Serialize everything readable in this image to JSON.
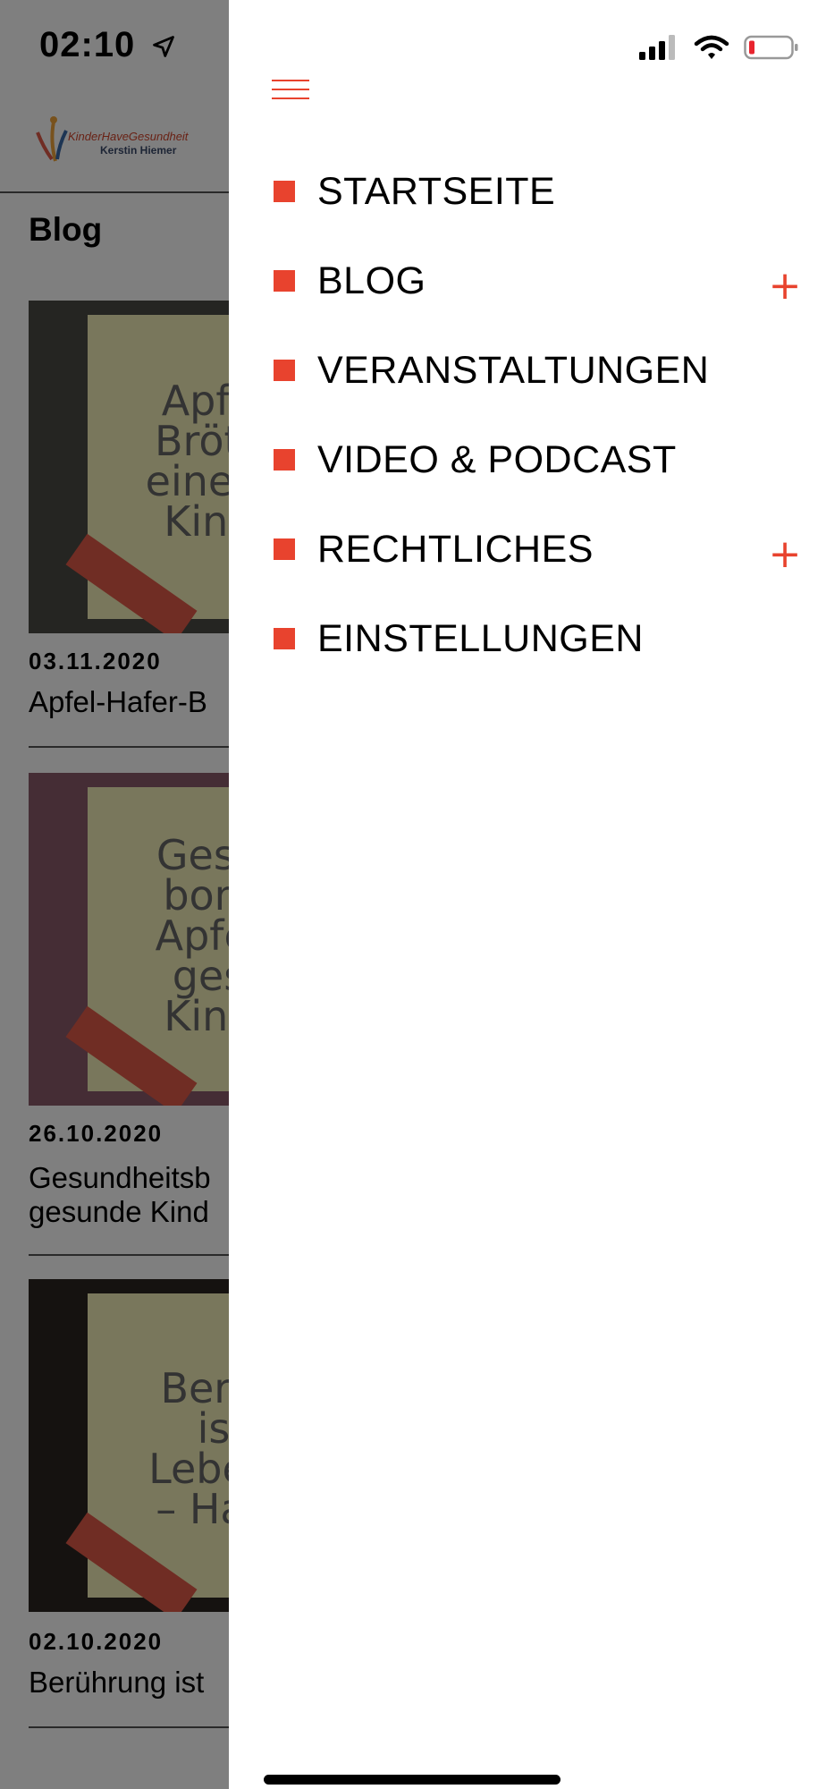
{
  "status_bar": {
    "time": "02:10"
  },
  "page": {
    "logo": {
      "line1": "KinderHaveGesundheit",
      "line2": "Kerstin Hiemer"
    },
    "heading": "Blog",
    "posts": [
      {
        "date": "03.11.2020",
        "title": "Apfel-Hafer-B",
        "image_text": "Apfel-\nBrötch\neine ge\nKinde"
      },
      {
        "date": "26.10.2020",
        "title": "Gesundheitsb\ngesunde Kind",
        "image_text": "Gesun\nbomb\nApfel f\ngesu\nKinde"
      },
      {
        "date": "02.10.2020",
        "title": "Berührung ist",
        "image_text": "Berüh\nist\nLebens\n– Haut"
      }
    ]
  },
  "drawer": {
    "menu_icon": "hamburger-menu-icon",
    "accent_color": "#e8432e",
    "items": [
      {
        "label": "STARTSEITE",
        "expandable": false
      },
      {
        "label": "BLOG",
        "expandable": true
      },
      {
        "label": "VERANSTALTUNGEN",
        "expandable": false
      },
      {
        "label": "VIDEO & PODCAST",
        "expandable": false
      },
      {
        "label": "RECHTLICHES",
        "expandable": true
      },
      {
        "label": "EINSTELLUNGEN",
        "expandable": false
      }
    ],
    "expand_icon_glyph": "+"
  }
}
